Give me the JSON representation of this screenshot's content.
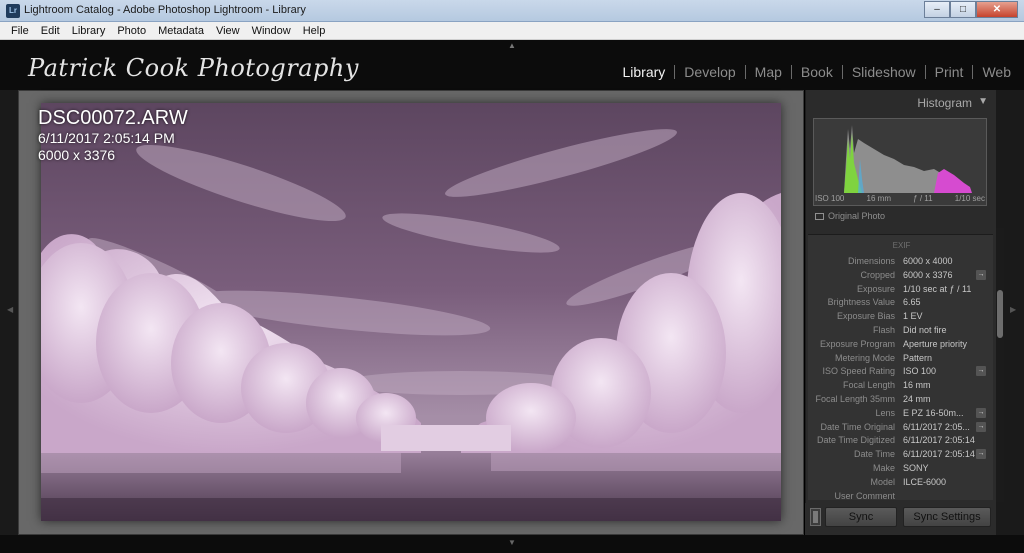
{
  "window": {
    "app_icon": "Lr",
    "title": "Lightroom Catalog - Adobe Photoshop Lightroom - Library",
    "buttons": {
      "minimize": "‒",
      "maximize": "□",
      "close": "✕"
    }
  },
  "menu": [
    "File",
    "Edit",
    "Library",
    "Photo",
    "Metadata",
    "View",
    "Window",
    "Help"
  ],
  "identity_plate": "Patrick Cook Photography",
  "modules": [
    {
      "label": "Library",
      "active": true
    },
    {
      "label": "Develop",
      "active": false
    },
    {
      "label": "Map",
      "active": false
    },
    {
      "label": "Book",
      "active": false
    },
    {
      "label": "Slideshow",
      "active": false
    },
    {
      "label": "Print",
      "active": false
    },
    {
      "label": "Web",
      "active": false
    }
  ],
  "loupe_info": {
    "filename": "DSC00072.ARW",
    "datetime": "6/11/2017 2:05:14 PM",
    "dimensions": "6000 x 3376"
  },
  "histogram": {
    "title": "Histogram",
    "iso": "ISO 100",
    "focal": "16 mm",
    "aperture": "ƒ / 11",
    "shutter": "1/10 sec",
    "original_photo_label": "Original Photo"
  },
  "metadata": {
    "section": "EXIF",
    "rows": [
      {
        "label": "Dimensions",
        "value": "6000 x 4000",
        "jump": false
      },
      {
        "label": "Cropped",
        "value": "6000 x 3376",
        "jump": true
      },
      {
        "label": "Exposure",
        "value": "1/10 sec at ƒ / 11",
        "jump": false
      },
      {
        "label": "Brightness Value",
        "value": "6.65",
        "jump": false
      },
      {
        "label": "Exposure Bias",
        "value": "1 EV",
        "jump": false
      },
      {
        "label": "Flash",
        "value": "Did not fire",
        "jump": false
      },
      {
        "label": "Exposure Program",
        "value": "Aperture priority",
        "jump": false
      },
      {
        "label": "Metering Mode",
        "value": "Pattern",
        "jump": false
      },
      {
        "label": "ISO Speed Rating",
        "value": "ISO 100",
        "jump": true
      },
      {
        "label": "Focal Length",
        "value": "16 mm",
        "jump": false
      },
      {
        "label": "Focal Length 35mm",
        "value": "24 mm",
        "jump": false
      },
      {
        "label": "Lens",
        "value": "E PZ 16-50m...",
        "jump": true
      },
      {
        "label": "Date Time Original",
        "value": "6/11/2017 2:05...",
        "jump": true
      },
      {
        "label": "Date Time Digitized",
        "value": "6/11/2017 2:05:14",
        "jump": false
      },
      {
        "label": "Date Time",
        "value": "6/11/2017 2:05:14",
        "jump": true
      },
      {
        "label": "Make",
        "value": "SONY",
        "jump": false
      },
      {
        "label": "Model",
        "value": "ILCE-6000",
        "jump": false
      },
      {
        "label": "User Comment",
        "value": "",
        "jump": false
      }
    ]
  },
  "sync": {
    "sync_label": "Sync",
    "sync_settings_label": "Sync Settings"
  },
  "colors": {
    "accent": "#f2f2f2",
    "photo_tint": "#7b5e7b"
  }
}
